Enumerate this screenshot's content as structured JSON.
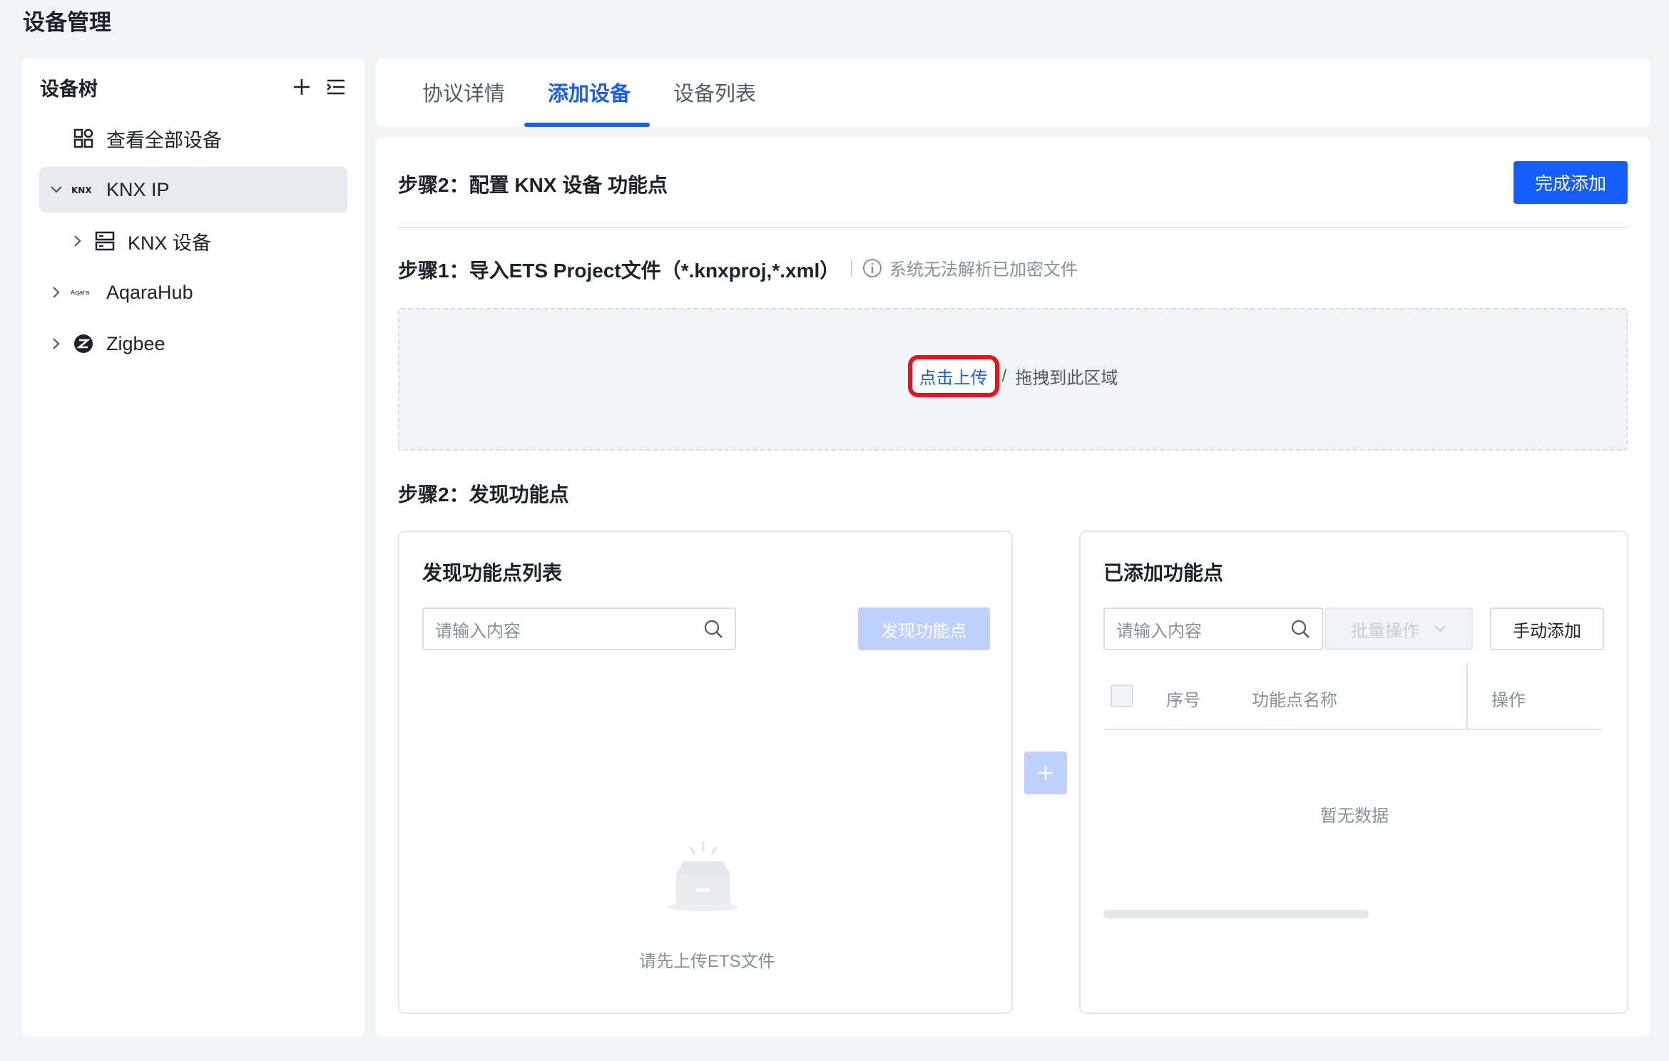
{
  "page_title": "设备管理",
  "tree": {
    "title": "设备树",
    "items": [
      {
        "label": "查看全部设备",
        "icon": "grid-icon"
      },
      {
        "label": "KNX IP",
        "icon": "knx-icon",
        "expanded": true,
        "selected": true
      },
      {
        "label": "KNX 设备",
        "icon": "server-icon"
      },
      {
        "label": "AqaraHub",
        "icon": "aqara-icon"
      },
      {
        "label": "Zigbee",
        "icon": "zigbee-icon"
      }
    ]
  },
  "tabs": [
    {
      "label": "协议详情"
    },
    {
      "label": "添加设备",
      "active": true
    },
    {
      "label": "设备列表"
    }
  ],
  "main": {
    "config_title": "步骤2：配置 KNX 设备 功能点",
    "finish_button": "完成添加",
    "step1_title": "步骤1：导入ETS Project文件（*.knxproj,*.xml）",
    "step1_hint": "系统无法解析已加密文件",
    "upload_link": "点击上传",
    "upload_sep": "/",
    "upload_drag": "拖拽到此区域",
    "step2_title": "步骤2：发现功能点"
  },
  "discover_card": {
    "title": "发现功能点列表",
    "search_placeholder": "请输入内容",
    "discover_button": "发现功能点",
    "empty_text": "请先上传ETS文件"
  },
  "added_card": {
    "title": "已添加功能点",
    "search_placeholder": "请输入内容",
    "batch_button": "批量操作",
    "manual_button": "手动添加",
    "columns": [
      "序号",
      "功能点名称",
      "操作"
    ],
    "empty_text": "暂无数据"
  },
  "colors": {
    "primary": "#165dff",
    "primary_light": "#bed1fe",
    "highlight": "#e8111c"
  }
}
